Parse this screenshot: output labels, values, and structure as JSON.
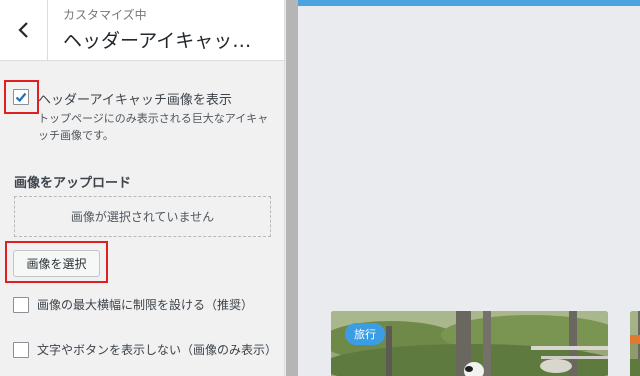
{
  "header": {
    "subtitle": "カスタマイズ中",
    "title": "ヘッダーアイキャッ…"
  },
  "show_header_eyecatch": {
    "label": "ヘッダーアイキャッチ画像を表示",
    "description": "トップページにのみ表示される巨大なアイキャッチ画像です。",
    "checked": true
  },
  "upload": {
    "title": "画像をアップロード",
    "placeholder": "画像が選択されていません",
    "select_button": "画像を選択"
  },
  "options": [
    {
      "label": "画像の最大横幅に制限を設ける（推奨）",
      "checked": false
    },
    {
      "label": "文字やボタンを表示しない（画像のみ表示）",
      "checked": false
    }
  ],
  "preview": {
    "card_badge": "旅行",
    "accent_color": "#4aa3df",
    "badge_color": "#3b9ee5"
  }
}
